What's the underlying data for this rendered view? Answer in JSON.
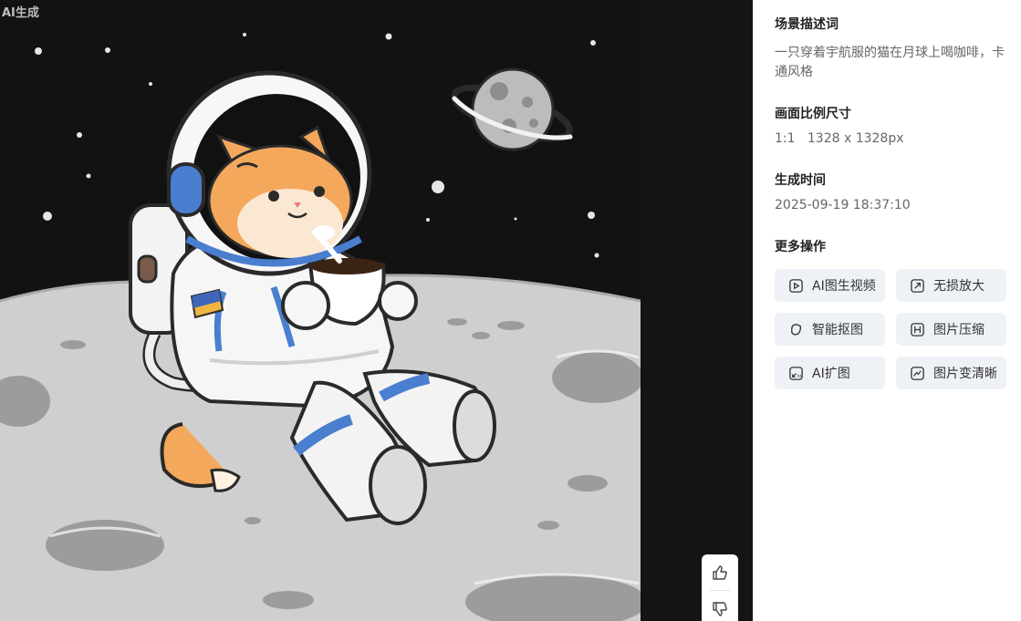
{
  "badge": {
    "label": "AI生成"
  },
  "info": {
    "scene_title": "场景描述词",
    "scene_text": "一只穿着宇航服的猫在月球上喝咖啡，卡通风格",
    "ratio_title": "画面比例尺寸",
    "ratio_value": "1:1   1328 x 1328px",
    "time_title": "生成时间",
    "time_value": "2025-09-19 18:37:10",
    "ops_title": "更多操作"
  },
  "operations": [
    {
      "label": "AI图生视频",
      "icon": "image-video-icon"
    },
    {
      "label": "无损放大",
      "icon": "upscale-icon"
    },
    {
      "label": "智能抠图",
      "icon": "cutout-icon"
    },
    {
      "label": "图片压缩",
      "icon": "compress-icon"
    },
    {
      "label": "AI扩图",
      "icon": "expand-icon"
    },
    {
      "label": "图片变清晰",
      "icon": "sharpen-icon"
    }
  ],
  "feedback": {
    "like_icon": "thumbs-up-icon",
    "dislike_icon": "thumbs-down-icon"
  }
}
